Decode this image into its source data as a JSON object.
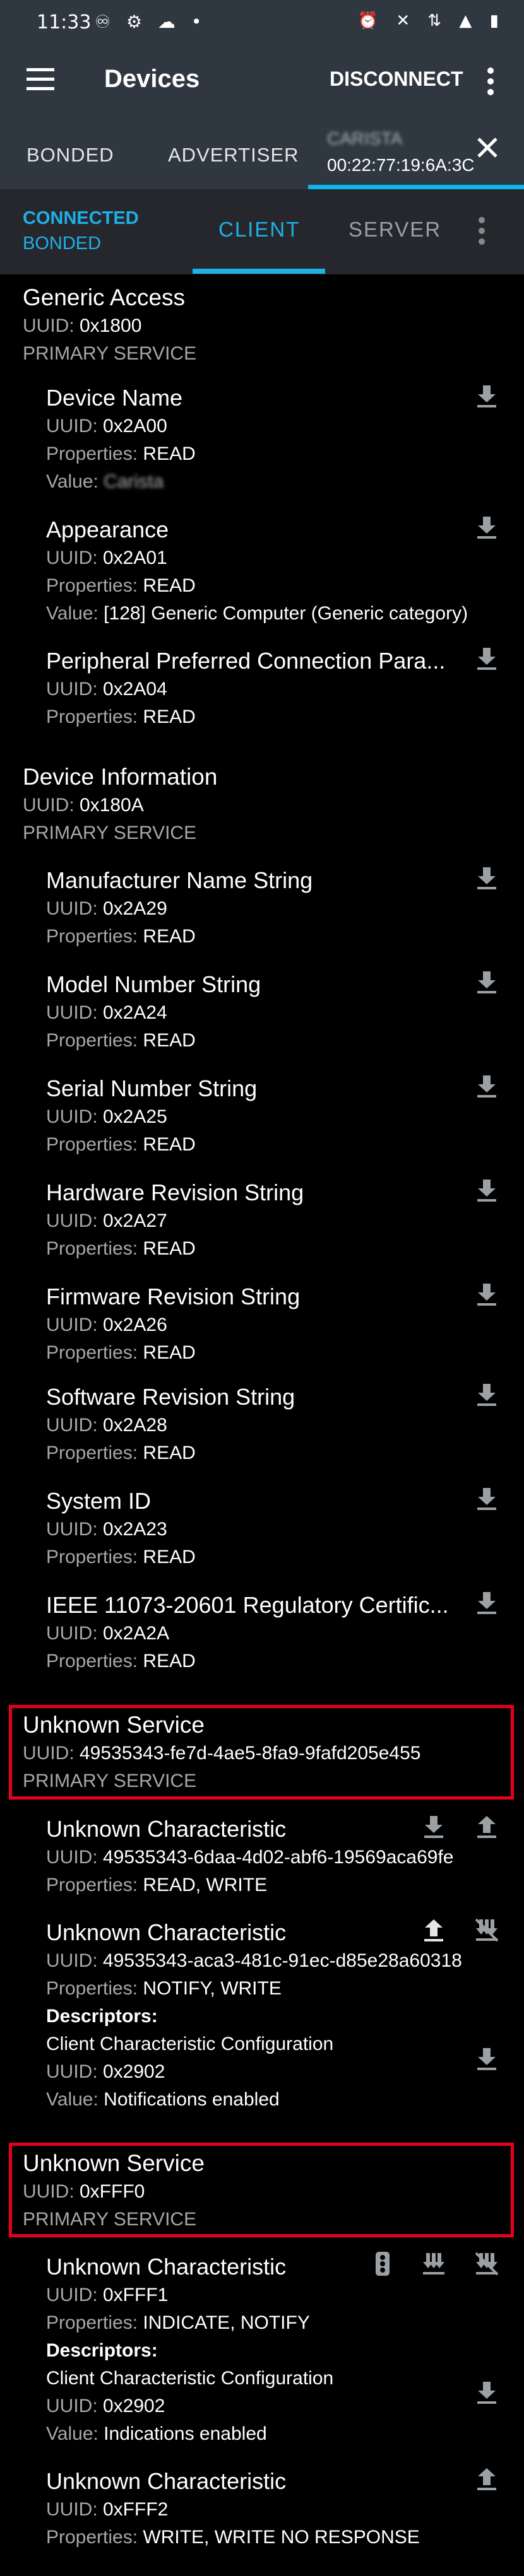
{
  "status_bar": {
    "time": "11:33",
    "left_icons": "♾ ⚙ ☁ •",
    "right_icons": "⏰ ✕ ⇅ ▲ ▮"
  },
  "app_bar": {
    "title": "Devices",
    "disconnect_label": "DISCONNECT"
  },
  "tabs": {
    "bonded": "BONDED",
    "advertiser": "ADVERTISER",
    "device_name": "CARISTA",
    "device_mac": "00:22:77:19:6A:3C"
  },
  "subtabs": {
    "connected": "CONNECTED",
    "bonded": "BONDED",
    "client": "CLIENT",
    "server": "SERVER"
  },
  "labels": {
    "uuid": "UUID: ",
    "properties": "Properties: ",
    "value": "Value: ",
    "descriptors": "Descriptors:"
  },
  "services": [
    {
      "name": "Generic Access",
      "uuid": "0x1800",
      "type": "PRIMARY SERVICE",
      "characteristics": [
        {
          "name": "Device Name",
          "uuid": "0x2A00",
          "properties": "READ",
          "value": "Carista"
        },
        {
          "name": "Appearance",
          "uuid": "0x2A01",
          "properties": "READ",
          "value": "[128] Generic Computer (Generic category)"
        },
        {
          "name": "Peripheral Preferred Connection Para...",
          "uuid": "0x2A04",
          "properties": "READ"
        }
      ]
    },
    {
      "name": "Device Information",
      "uuid": "0x180A",
      "type": "PRIMARY SERVICE",
      "characteristics": [
        {
          "name": "Manufacturer Name String",
          "uuid": "0x2A29",
          "properties": "READ"
        },
        {
          "name": "Model Number String",
          "uuid": "0x2A24",
          "properties": "READ"
        },
        {
          "name": "Serial Number String",
          "uuid": "0x2A25",
          "properties": "READ"
        },
        {
          "name": "Hardware Revision String",
          "uuid": "0x2A27",
          "properties": "READ"
        },
        {
          "name": "Firmware Revision String",
          "uuid": "0x2A26",
          "properties": "READ"
        },
        {
          "name": "Software Revision String",
          "uuid": "0x2A28",
          "properties": "READ"
        },
        {
          "name": "System ID",
          "uuid": "0x2A23",
          "properties": "READ"
        },
        {
          "name": "IEEE 11073-20601 Regulatory Certific...",
          "uuid": "0x2A2A",
          "properties": "READ"
        }
      ]
    },
    {
      "name": "Unknown Service",
      "uuid": "49535343-fe7d-4ae5-8fa9-9fafd205e455",
      "type": "PRIMARY SERVICE",
      "characteristics": [
        {
          "name": "Unknown Characteristic",
          "uuid": "49535343-6daa-4d02-abf6-19569aca69fe",
          "properties": "READ, WRITE"
        },
        {
          "name": "Unknown Characteristic",
          "uuid": "49535343-aca3-481c-91ec-d85e28a60318",
          "properties": "NOTIFY, WRITE",
          "descriptor": {
            "name": "Client Characteristic Configuration",
            "uuid": "0x2902",
            "value": "Notifications enabled"
          }
        }
      ]
    },
    {
      "name": "Unknown Service",
      "uuid": "0xFFF0",
      "type": "PRIMARY SERVICE",
      "characteristics": [
        {
          "name": "Unknown Characteristic",
          "uuid": "0xFFF1",
          "properties": "INDICATE, NOTIFY",
          "descriptor": {
            "name": "Client Characteristic Configuration",
            "uuid": "0x2902",
            "value": "Indications enabled"
          }
        },
        {
          "name": "Unknown Characteristic",
          "uuid": "0xFFF2",
          "properties": "WRITE, WRITE NO RESPONSE"
        }
      ]
    }
  ],
  "colors": {
    "toolbar": "#2f3840",
    "accent": "#1eb0e6",
    "highlight_box": "#e5001c",
    "secondary_text": "#a7a7a7"
  }
}
